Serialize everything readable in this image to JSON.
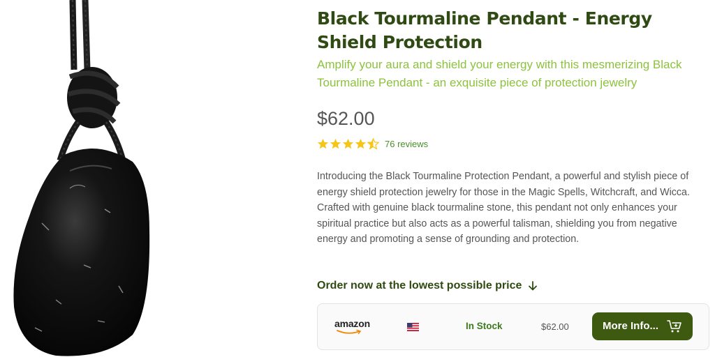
{
  "product": {
    "title": "Black Tourmaline Pendant - Energy Shield Protection",
    "subtitle": "Amplify your aura and shield your energy with this mesmerizing Black Tourmaline Pendant - an exquisite piece of protection jewelry",
    "price": "$62.00",
    "rating": 4.5,
    "reviews_label": "76 reviews",
    "description": "Introducing the Black Tourmaline Protection Pendant, a powerful and stylish piece of energy shield protection jewelry for those in the Magic Spells, Witchcraft, and Wicca. Crafted with genuine black tourmaline stone, this pendant not only enhances your spiritual practice but also acts as a powerful talisman, shielding you from negative energy and promoting a sense of grounding and protection.",
    "image_icon": "pendant-image"
  },
  "order": {
    "heading": "Order now at the lowest possible price",
    "arrow_icon": "arrow-down-icon"
  },
  "offer": {
    "store": "amazon",
    "flag_icon": "us-flag-icon",
    "stock_status": "In Stock",
    "price": "$62.00",
    "button_label": "More Info...",
    "button_icon": "cart-icon"
  },
  "colors": {
    "title": "#2f4a12",
    "subtitle": "#8cc23d",
    "stars": "#f5c518",
    "button": "#3d5a10",
    "stock": "#3e7a1f"
  }
}
